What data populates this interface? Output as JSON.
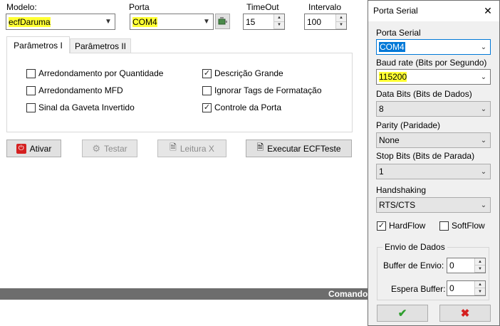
{
  "main": {
    "modelo_label": "Modelo:",
    "modelo_value": "ecfDaruma",
    "porta_label": "Porta",
    "porta_value": "COM4",
    "timeout_label": "TimeOut",
    "timeout_value": "15",
    "intervalo_label": "Intervalo",
    "intervalo_value": "100",
    "tabs": [
      {
        "label": "Parâmetros I"
      },
      {
        "label": "Parâmetros II"
      }
    ],
    "checkboxes": [
      {
        "label": "Arredondamento por Quantidade",
        "checked": false
      },
      {
        "label": "Arredondamento MFD",
        "checked": false
      },
      {
        "label": "Sinal da Gaveta Invertido",
        "checked": false
      },
      {
        "label": "Descrição Grande",
        "checked": true
      },
      {
        "label": "Ignorar Tags de Formatação",
        "checked": false
      },
      {
        "label": "Controle da Porta",
        "checked": true
      }
    ],
    "buttons": {
      "ativar": "Ativar",
      "testar": "Testar",
      "leitura": "Leitura X",
      "executar": "Executar ECFTeste"
    },
    "statusbar_text": "Comando"
  },
  "dialog": {
    "title": "Porta Serial",
    "close_glyph": "✕",
    "porta_serial_label": "Porta Serial",
    "porta_serial_value": "COM4",
    "baud_label": "Baud rate (Bits por Segundo)",
    "baud_value": "115200",
    "data_bits_label": "Data Bits (Bits de Dados)",
    "data_bits_value": "8",
    "parity_label": "Parity (Paridade)",
    "parity_value": "None",
    "stop_bits_label": "Stop Bits (Bits de Parada)",
    "stop_bits_value": "1",
    "handshaking_label": "Handshaking",
    "handshaking_value": "RTS/CTS",
    "hardflow_label": "HardFlow",
    "hardflow_checked": true,
    "softflow_label": "SoftFlow",
    "softflow_checked": false,
    "envio_group_label": "Envio de Dados",
    "buffer_envio_label": "Buffer de Envio:",
    "buffer_envio_value": "0",
    "espera_buffer_label": "Espera Buffer:",
    "espera_buffer_value": "0",
    "ok_glyph": "✔",
    "cancel_glyph": "✖"
  },
  "colors": {
    "highlight": "#ffff33",
    "selection": "#0078d7",
    "statusbar": "#6d6d6d",
    "ok_green": "#2e9e2e",
    "cancel_red": "#d42020"
  }
}
